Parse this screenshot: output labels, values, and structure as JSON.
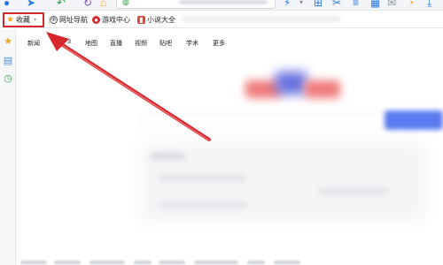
{
  "bookmarks_bar": {
    "favorites_label": "收藏",
    "items": [
      {
        "label": "网址导航",
        "icon": "globe-icon"
      },
      {
        "label": "游戏中心",
        "icon": "game-icon"
      },
      {
        "label": "小说大全",
        "icon": "book-icon"
      }
    ]
  },
  "main": {
    "nav_links": [
      "新闻",
      "地图",
      "直播",
      "视频",
      "贴吧",
      "学术",
      "更多"
    ],
    "partial_link": "3"
  },
  "colors": {
    "highlight_box": "#d6272b",
    "arrow": "#d9262a",
    "star": "#f5a623"
  }
}
